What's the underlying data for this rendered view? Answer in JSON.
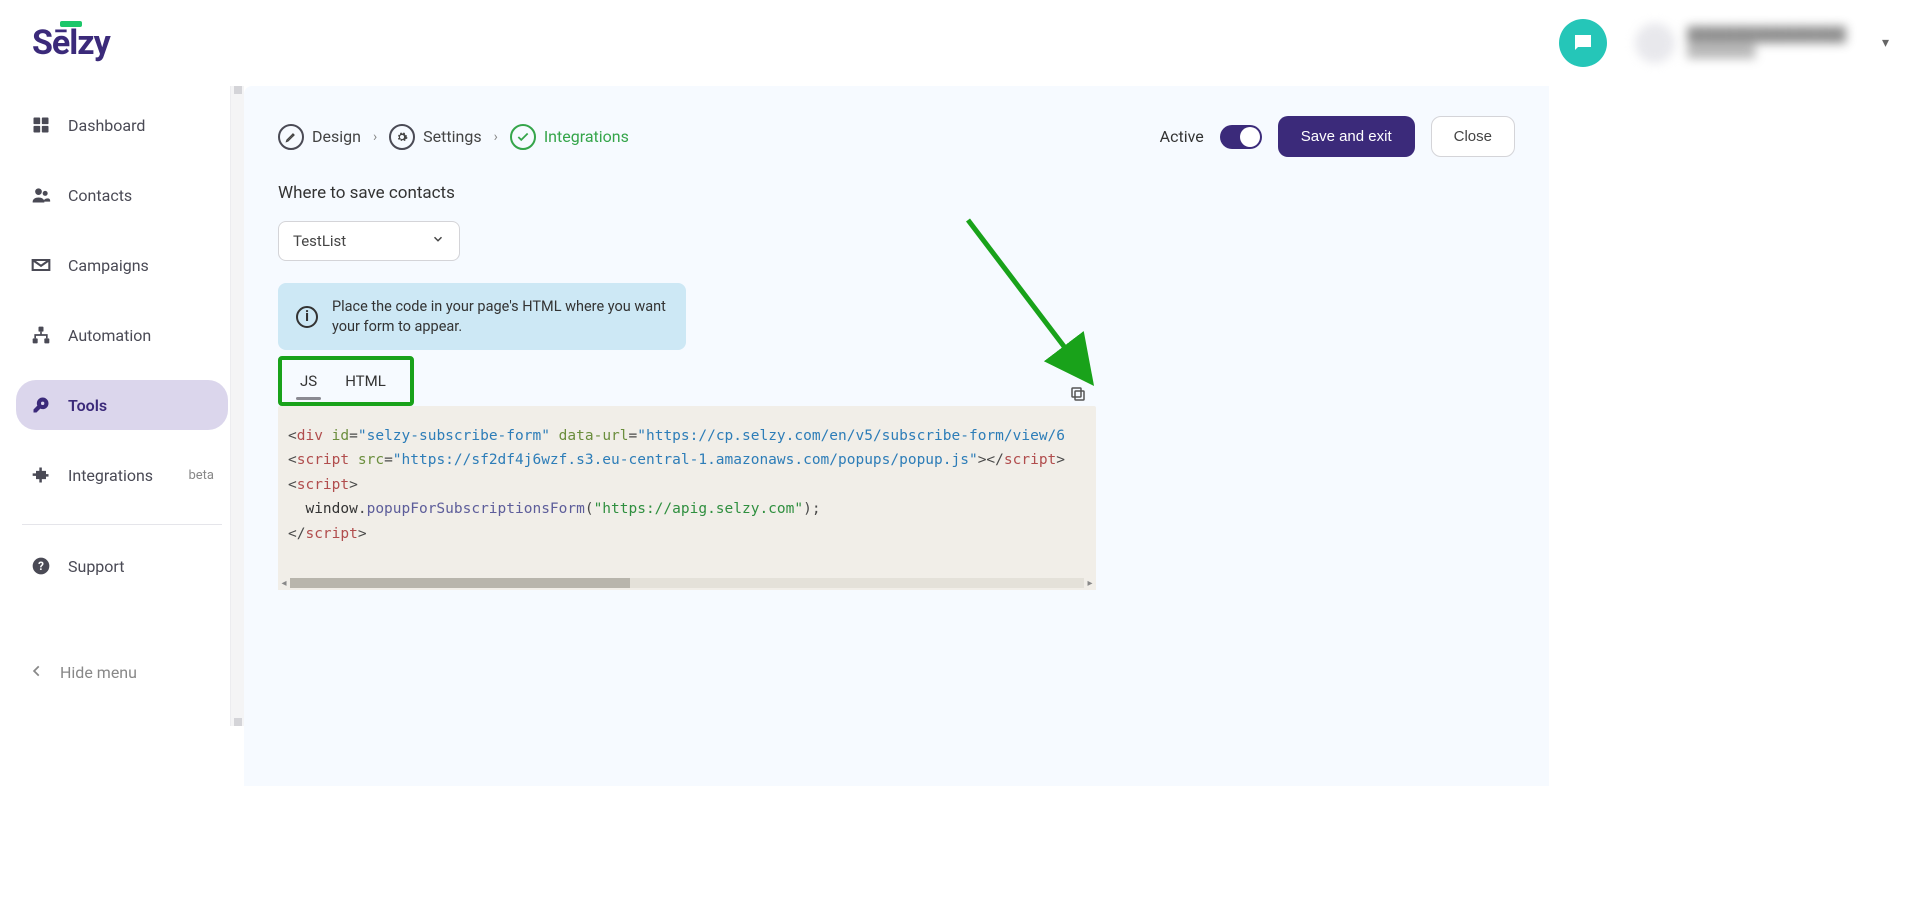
{
  "header": {
    "logo_text": "Sēlzy",
    "user_name": "████████████████",
    "user_sub": "████████"
  },
  "sidebar": {
    "items": [
      {
        "label": "Dashboard",
        "icon": "dashboard-icon"
      },
      {
        "label": "Contacts",
        "icon": "contacts-icon"
      },
      {
        "label": "Campaigns",
        "icon": "campaigns-icon"
      },
      {
        "label": "Automation",
        "icon": "automation-icon"
      },
      {
        "label": "Tools",
        "icon": "tools-icon",
        "active": true
      },
      {
        "label": "Integrations",
        "icon": "integrations-icon",
        "badge": "beta"
      }
    ],
    "support_label": "Support",
    "hide_label": "Hide menu"
  },
  "breadcrumb": {
    "steps": [
      {
        "label": "Design",
        "icon": "pencil-icon"
      },
      {
        "label": "Settings",
        "icon": "gear-icon"
      },
      {
        "label": "Integrations",
        "icon": "check-icon",
        "done": true
      }
    ]
  },
  "top_actions": {
    "active_label": "Active",
    "save_label": "Save and exit",
    "close_label": "Close"
  },
  "section": {
    "title": "Where to save contacts",
    "list_selected": "TestList",
    "info_text": "Place the code in your page's HTML where you want your form to appear."
  },
  "code_tabs": {
    "js": "JS",
    "html": "HTML"
  },
  "code": {
    "div_id": "selzy-subscribe-form",
    "data_url": "https://cp.selzy.com/en/v5/subscribe-form/view/6",
    "script_src": "https://sf2df4j6wzf.s3.eu-central-1.amazonaws.com/popups/popup.js",
    "func_obj": "window",
    "func_name": "popupForSubscriptionsForm",
    "func_arg": "https://apig.selzy.com"
  }
}
